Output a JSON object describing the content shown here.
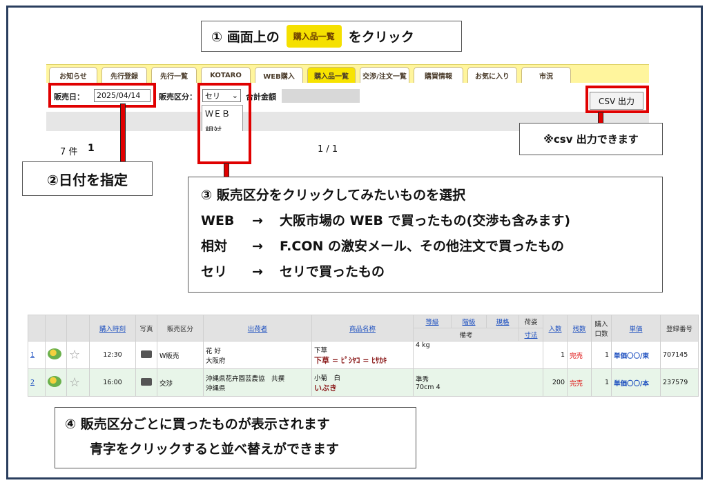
{
  "step1": {
    "prefix": "① 画面上の",
    "chip": "購入品一覧",
    "suffix": "をクリック"
  },
  "tabs": [
    "お知らせ",
    "先行登録",
    "先行一覧",
    "KOTARO",
    "WEB購入",
    "購入品一覧",
    "交渉/注文一覧",
    "購買情報",
    "お気に入り",
    "市況"
  ],
  "filters": {
    "date_label": "販売日：",
    "date_value": "2025/04/14",
    "type_label": "販売区分：",
    "type_value": "セリ",
    "total_label": "合計金額"
  },
  "dropdown_options": [
    "ＷＥＢ",
    "相対",
    "セリ"
  ],
  "csv_button": "CSV 出力",
  "csv_note": "※csv 出力できます",
  "count": {
    "label": "7 件",
    "page": "1",
    "pager": "1 / 1"
  },
  "step2": "②日付を指定",
  "step3": {
    "title": "③ 販売区分をクリックしてみたいものを選択",
    "rows": [
      {
        "a": "WEB",
        "b": "→",
        "c": "大阪市場の WEB で買ったもの(交渉も含みます)"
      },
      {
        "a": "相対",
        "b": "→",
        "c": "F.CON の激安メール、その他注文で買ったもの"
      },
      {
        "a": "セリ",
        "b": "→",
        "c": "セリで買ったもの"
      }
    ]
  },
  "table": {
    "headers": [
      "購入時刻",
      "写真",
      "販売区分",
      "出荷者",
      "商品名称",
      "等級",
      "階級",
      "規格",
      "荷姿",
      "入数",
      "残数",
      "購入口数",
      "単価",
      "登録番号"
    ],
    "sub_headers": {
      "remarks": "備考",
      "dims": "寸法"
    },
    "rows": [
      {
        "no": "1",
        "time": "12:30",
        "type": "W販売",
        "shipper1": "花 好",
        "shipper2": "大阪府",
        "item1": "下草",
        "item2": "下草 = ﾋﾟｼﾔｺ = ﾋｻｶｷ",
        "grade": "4 kg",
        "remark": "",
        "qty": "1",
        "remain": "完売",
        "units": "1",
        "price": "単価〇〇/束",
        "reg": "707145"
      },
      {
        "no": "2",
        "time": "16:00",
        "type": "交渉",
        "shipper1": "沖縄県花卉園芸農協　共撰",
        "shipper2": "沖縄県",
        "item1": "小菊　白",
        "item2": "いぶき",
        "grade": "準秀",
        "remark": "70cm 4",
        "qty": "200",
        "remain": "完売",
        "units": "1",
        "price": "単価〇〇/本",
        "reg": "237579"
      }
    ]
  },
  "step4": [
    "④ 販売区分ごとに買ったものが表示されます",
    "青字をクリックすると並べ替えができます"
  ]
}
